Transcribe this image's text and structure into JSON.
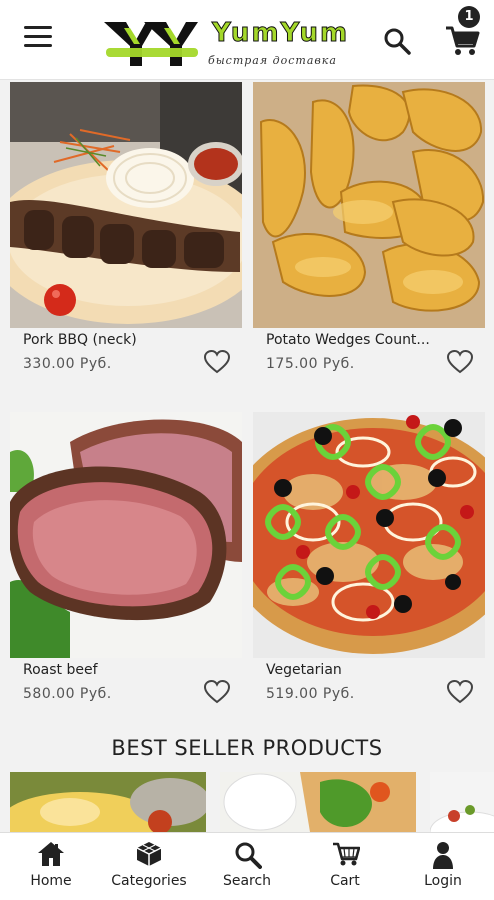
{
  "header": {
    "brand_name": "YumYum",
    "brand_tagline": "быстрая доставка",
    "cart_count": "1"
  },
  "products": [
    {
      "name": "Pork BBQ (neck)",
      "price": "330.00 Руб."
    },
    {
      "name": "Potato Wedges Count...",
      "price": "175.00 Руб."
    },
    {
      "name": "Roast beef",
      "price": "580.00 Руб."
    },
    {
      "name": "Vegetarian",
      "price": "519.00 Руб."
    }
  ],
  "best_sellers": {
    "title": "BEST SELLER PRODUCTS"
  },
  "bottom_nav": {
    "items": [
      {
        "label": "Home",
        "icon": "home-icon"
      },
      {
        "label": "Categories",
        "icon": "categories-icon"
      },
      {
        "label": "Search",
        "icon": "search-icon"
      },
      {
        "label": "Cart",
        "icon": "cart-icon"
      },
      {
        "label": "Login",
        "icon": "user-icon"
      }
    ]
  },
  "colors": {
    "brand_green": "#a4d82a",
    "text_dark": "#222222",
    "background": "#f2f2f2"
  }
}
